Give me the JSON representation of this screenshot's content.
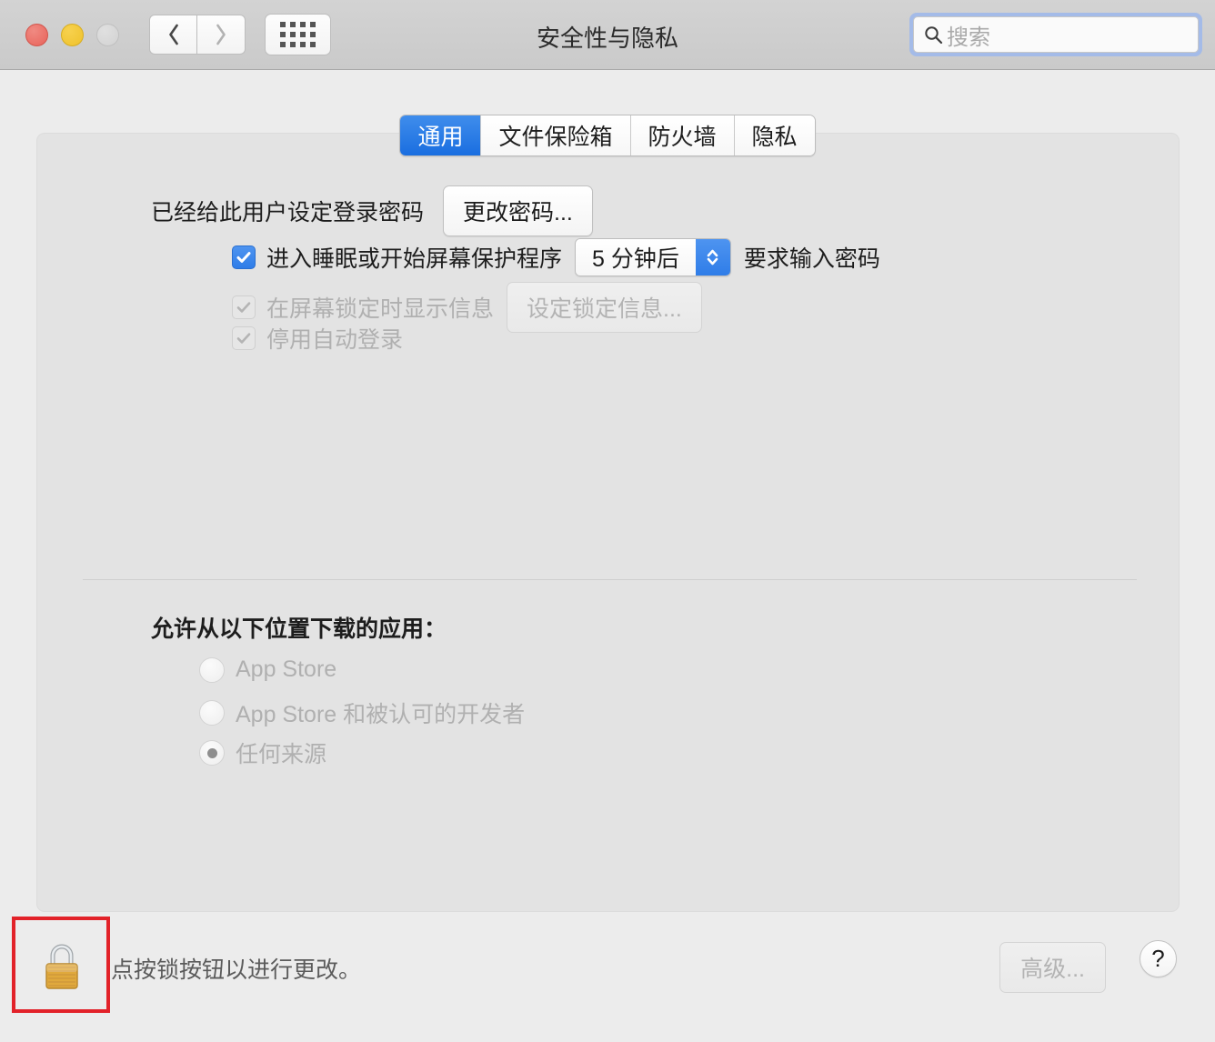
{
  "window": {
    "title": "安全性与隐私",
    "traffic_lights": [
      "close",
      "minimize",
      "maximize"
    ],
    "nav": {
      "back": "‹",
      "forward": "›",
      "grid": "show-all"
    }
  },
  "search": {
    "placeholder": "搜索",
    "icon": "search-icon",
    "focus_color": "#a4bbe8"
  },
  "tabs": [
    {
      "label": "通用",
      "active": true
    },
    {
      "label": "文件保险箱",
      "active": false
    },
    {
      "label": "防火墙",
      "active": false
    },
    {
      "label": "隐私",
      "active": false
    }
  ],
  "general": {
    "password_label": "已经给此用户设定登录密码",
    "change_password_button": "更改密码...",
    "require_password": {
      "checked": true,
      "enabled": true,
      "label_before": "进入睡眠或开始屏幕保护程序",
      "delay_value": "5 分钟后",
      "label_after": "要求输入密码"
    },
    "show_lock_message": {
      "checked": true,
      "enabled": false,
      "label": "在屏幕锁定时显示信息",
      "button": "设定锁定信息..."
    },
    "disable_auto_login": {
      "checked": true,
      "enabled": false,
      "label": "停用自动登录"
    }
  },
  "downloads": {
    "heading": "允许从以下位置下载的应用：",
    "options": [
      {
        "label": "App Store",
        "selected": false,
        "enabled": false
      },
      {
        "label": "App Store 和被认可的开发者",
        "selected": false,
        "enabled": false
      },
      {
        "label": "任何来源",
        "selected": true,
        "enabled": false
      }
    ]
  },
  "bottom": {
    "lock_icon": "lock-closed-icon",
    "lock_state": "locked",
    "lock_text": "点按锁按钮以进行更改。",
    "advanced_button": "高级...",
    "advanced_enabled": false,
    "help_button": "?",
    "highlight_color": "#e22229"
  }
}
